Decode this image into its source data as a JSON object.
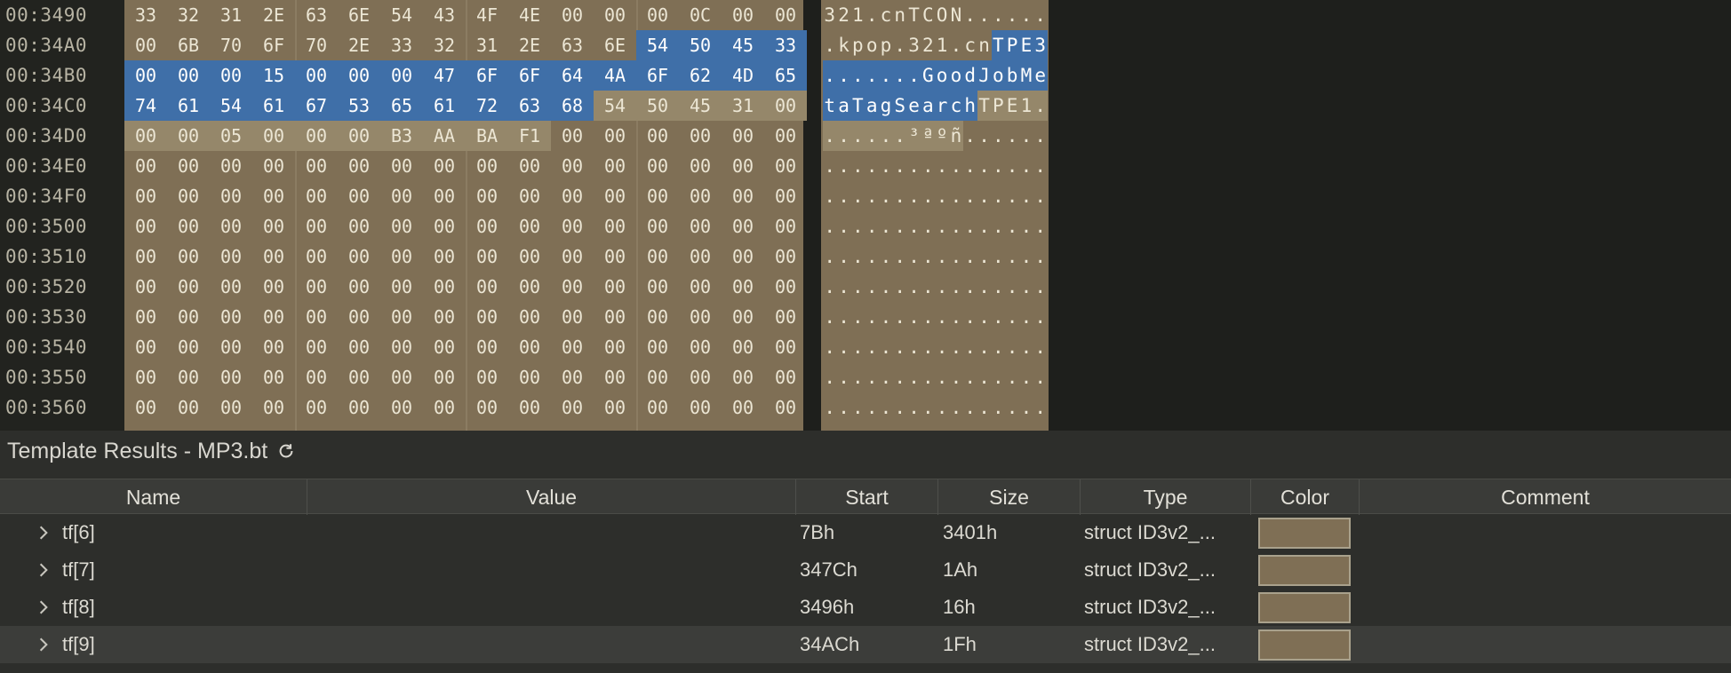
{
  "hex": {
    "rows": [
      {
        "addr": "00:3490",
        "bytes": [
          "33",
          "32",
          "31",
          "2E",
          "63",
          "6E",
          "54",
          "43",
          "4F",
          "4E",
          "00",
          "00",
          "00",
          "0C",
          "00",
          "00"
        ],
        "ascii": "321.cnTCON......",
        "sel_from": -1,
        "sel_to": -1,
        "hl_from": -1,
        "hl_to": -1
      },
      {
        "addr": "00:34A0",
        "bytes": [
          "00",
          "6B",
          "70",
          "6F",
          "70",
          "2E",
          "33",
          "32",
          "31",
          "2E",
          "63",
          "6E",
          "54",
          "50",
          "45",
          "33"
        ],
        "ascii": ".kpop.321.cnTPE3",
        "sel_from": 12,
        "sel_to": 15,
        "hl_from": -1,
        "hl_to": -1
      },
      {
        "addr": "00:34B0",
        "bytes": [
          "00",
          "00",
          "00",
          "15",
          "00",
          "00",
          "00",
          "47",
          "6F",
          "6F",
          "64",
          "4A",
          "6F",
          "62",
          "4D",
          "65"
        ],
        "ascii": ".......GoodJobMe",
        "sel_from": 0,
        "sel_to": 15,
        "hl_from": -1,
        "hl_to": -1
      },
      {
        "addr": "00:34C0",
        "bytes": [
          "74",
          "61",
          "54",
          "61",
          "67",
          "53",
          "65",
          "61",
          "72",
          "63",
          "68",
          "54",
          "50",
          "45",
          "31",
          "00"
        ],
        "ascii": "taTagSearchTPE1.",
        "sel_from": 0,
        "sel_to": 10,
        "hl_from": 11,
        "hl_to": 15
      },
      {
        "addr": "00:34D0",
        "bytes": [
          "00",
          "00",
          "05",
          "00",
          "00",
          "00",
          "B3",
          "AA",
          "BA",
          "F1",
          "00",
          "00",
          "00",
          "00",
          "00",
          "00"
        ],
        "ascii": "......³ªºñ......",
        "sel_from": -1,
        "sel_to": -1,
        "hl_from": 0,
        "hl_to": 9
      },
      {
        "addr": "00:34E0",
        "bytes": [
          "00",
          "00",
          "00",
          "00",
          "00",
          "00",
          "00",
          "00",
          "00",
          "00",
          "00",
          "00",
          "00",
          "00",
          "00",
          "00"
        ],
        "ascii": "................",
        "sel_from": -1,
        "sel_to": -1,
        "hl_from": -1,
        "hl_to": -1
      },
      {
        "addr": "00:34F0",
        "bytes": [
          "00",
          "00",
          "00",
          "00",
          "00",
          "00",
          "00",
          "00",
          "00",
          "00",
          "00",
          "00",
          "00",
          "00",
          "00",
          "00"
        ],
        "ascii": "................",
        "sel_from": -1,
        "sel_to": -1,
        "hl_from": -1,
        "hl_to": -1
      },
      {
        "addr": "00:3500",
        "bytes": [
          "00",
          "00",
          "00",
          "00",
          "00",
          "00",
          "00",
          "00",
          "00",
          "00",
          "00",
          "00",
          "00",
          "00",
          "00",
          "00"
        ],
        "ascii": "................",
        "sel_from": -1,
        "sel_to": -1,
        "hl_from": -1,
        "hl_to": -1
      },
      {
        "addr": "00:3510",
        "bytes": [
          "00",
          "00",
          "00",
          "00",
          "00",
          "00",
          "00",
          "00",
          "00",
          "00",
          "00",
          "00",
          "00",
          "00",
          "00",
          "00"
        ],
        "ascii": "................",
        "sel_from": -1,
        "sel_to": -1,
        "hl_from": -1,
        "hl_to": -1
      },
      {
        "addr": "00:3520",
        "bytes": [
          "00",
          "00",
          "00",
          "00",
          "00",
          "00",
          "00",
          "00",
          "00",
          "00",
          "00",
          "00",
          "00",
          "00",
          "00",
          "00"
        ],
        "ascii": "................",
        "sel_from": -1,
        "sel_to": -1,
        "hl_from": -1,
        "hl_to": -1
      },
      {
        "addr": "00:3530",
        "bytes": [
          "00",
          "00",
          "00",
          "00",
          "00",
          "00",
          "00",
          "00",
          "00",
          "00",
          "00",
          "00",
          "00",
          "00",
          "00",
          "00"
        ],
        "ascii": "................",
        "sel_from": -1,
        "sel_to": -1,
        "hl_from": -1,
        "hl_to": -1
      },
      {
        "addr": "00:3540",
        "bytes": [
          "00",
          "00",
          "00",
          "00",
          "00",
          "00",
          "00",
          "00",
          "00",
          "00",
          "00",
          "00",
          "00",
          "00",
          "00",
          "00"
        ],
        "ascii": "................",
        "sel_from": -1,
        "sel_to": -1,
        "hl_from": -1,
        "hl_to": -1
      },
      {
        "addr": "00:3550",
        "bytes": [
          "00",
          "00",
          "00",
          "00",
          "00",
          "00",
          "00",
          "00",
          "00",
          "00",
          "00",
          "00",
          "00",
          "00",
          "00",
          "00"
        ],
        "ascii": "................",
        "sel_from": -1,
        "sel_to": -1,
        "hl_from": -1,
        "hl_to": -1
      },
      {
        "addr": "00:3560",
        "bytes": [
          "00",
          "00",
          "00",
          "00",
          "00",
          "00",
          "00",
          "00",
          "00",
          "00",
          "00",
          "00",
          "00",
          "00",
          "00",
          "00"
        ],
        "ascii": "................",
        "sel_from": -1,
        "sel_to": -1,
        "hl_from": -1,
        "hl_to": -1
      }
    ]
  },
  "template": {
    "title": "Template Results - MP3.bt",
    "columns": [
      "Name",
      "Value",
      "Start",
      "Size",
      "Type",
      "Color",
      "Comment"
    ],
    "rows": [
      {
        "name": "tf[6]",
        "value": "",
        "start": "7Bh",
        "size": "3401h",
        "type": "struct ID3v2_...",
        "color": "#7f6f55",
        "comment": ""
      },
      {
        "name": "tf[7]",
        "value": "",
        "start": "347Ch",
        "size": "1Ah",
        "type": "struct ID3v2_...",
        "color": "#7f6f55",
        "comment": ""
      },
      {
        "name": "tf[8]",
        "value": "",
        "start": "3496h",
        "size": "16h",
        "type": "struct ID3v2_...",
        "color": "#7f6f55",
        "comment": ""
      },
      {
        "name": "tf[9]",
        "value": "",
        "start": "34ACh",
        "size": "1Fh",
        "type": "struct ID3v2_...",
        "color": "#7f6f55",
        "comment": ""
      }
    ],
    "selected_row": 3
  },
  "colors": {
    "template_bg": "#7f6f55",
    "selection": "#3f6fa8",
    "highlight": "#95876a"
  }
}
